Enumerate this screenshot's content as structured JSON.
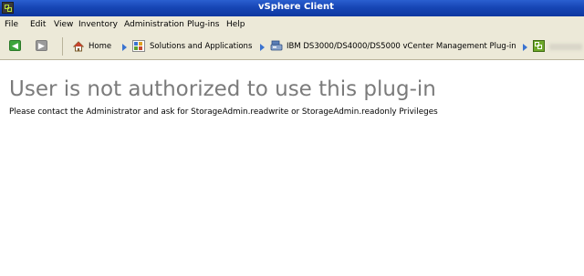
{
  "window": {
    "title": "vSphere Client"
  },
  "menu": {
    "items": [
      "File",
      "Edit",
      "View",
      "Inventory",
      "Administration",
      "Plug-ins",
      "Help"
    ]
  },
  "breadcrumb": {
    "items": [
      "Home",
      "Solutions and Applications",
      "IBM DS3000/DS4000/DS5000 vCenter Management Plug-in"
    ]
  },
  "main": {
    "heading": "User is not authorized to use this plug-in",
    "message": "Please contact the Administrator and ask for StorageAdmin.readwrite or StorageAdmin.readonly Privileges"
  },
  "colors": {
    "titlebar": "#1746b5",
    "chrome": "#ece9d8",
    "heading": "#7b7b7b",
    "back_button": "#3da53b",
    "forward_button": "#9a9a9a",
    "breadcrumb_arrow": "#3a73d0"
  },
  "icons": {
    "app": "vsphere-logo-icon",
    "back": "back-arrow-icon",
    "forward": "forward-arrow-icon",
    "home": "home-icon",
    "solutions": "solutions-grid-icon",
    "plugin": "storage-plugin-icon",
    "inventory": "vcenter-icon"
  }
}
